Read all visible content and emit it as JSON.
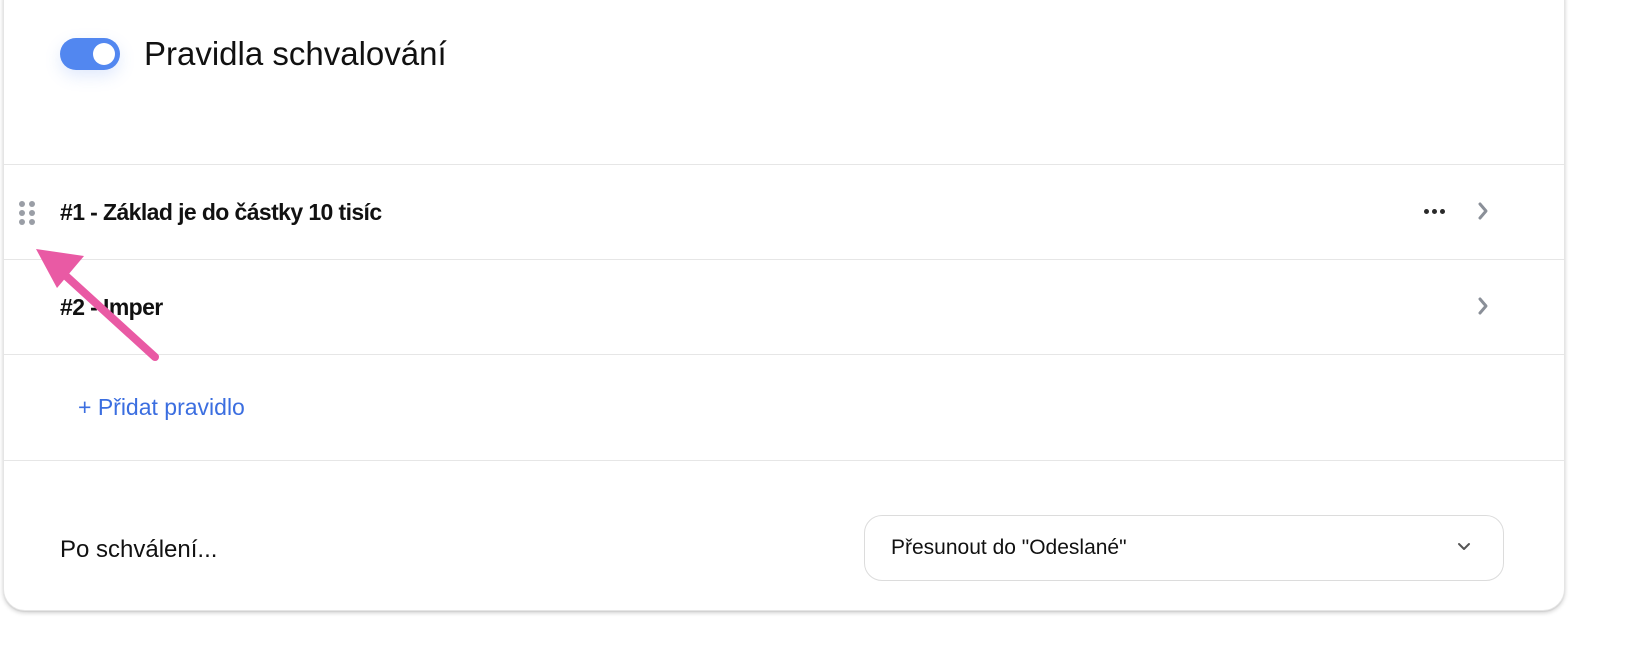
{
  "header": {
    "toggle_state": "on",
    "title": "Pravidla schvalování"
  },
  "rules": [
    {
      "label": "#1 - Základ je do částky 10 tisíc",
      "has_menu": true
    },
    {
      "label": "#2 - Imper",
      "has_menu": false
    }
  ],
  "add_rule": {
    "label": "+ Přidat pravidlo"
  },
  "after_approval": {
    "label": "Po schválení...",
    "selected_option": "Přesunout do \"Odeslané\""
  },
  "colors": {
    "accent": "#5287f0",
    "link": "#3b6ee0",
    "annotation_arrow": "#e95aa4"
  },
  "icons": {
    "drag": "drag-handle-icon",
    "more": "more-horizontal-icon",
    "chevron_right": "chevron-right-icon",
    "chevron_down": "chevron-down-icon"
  }
}
